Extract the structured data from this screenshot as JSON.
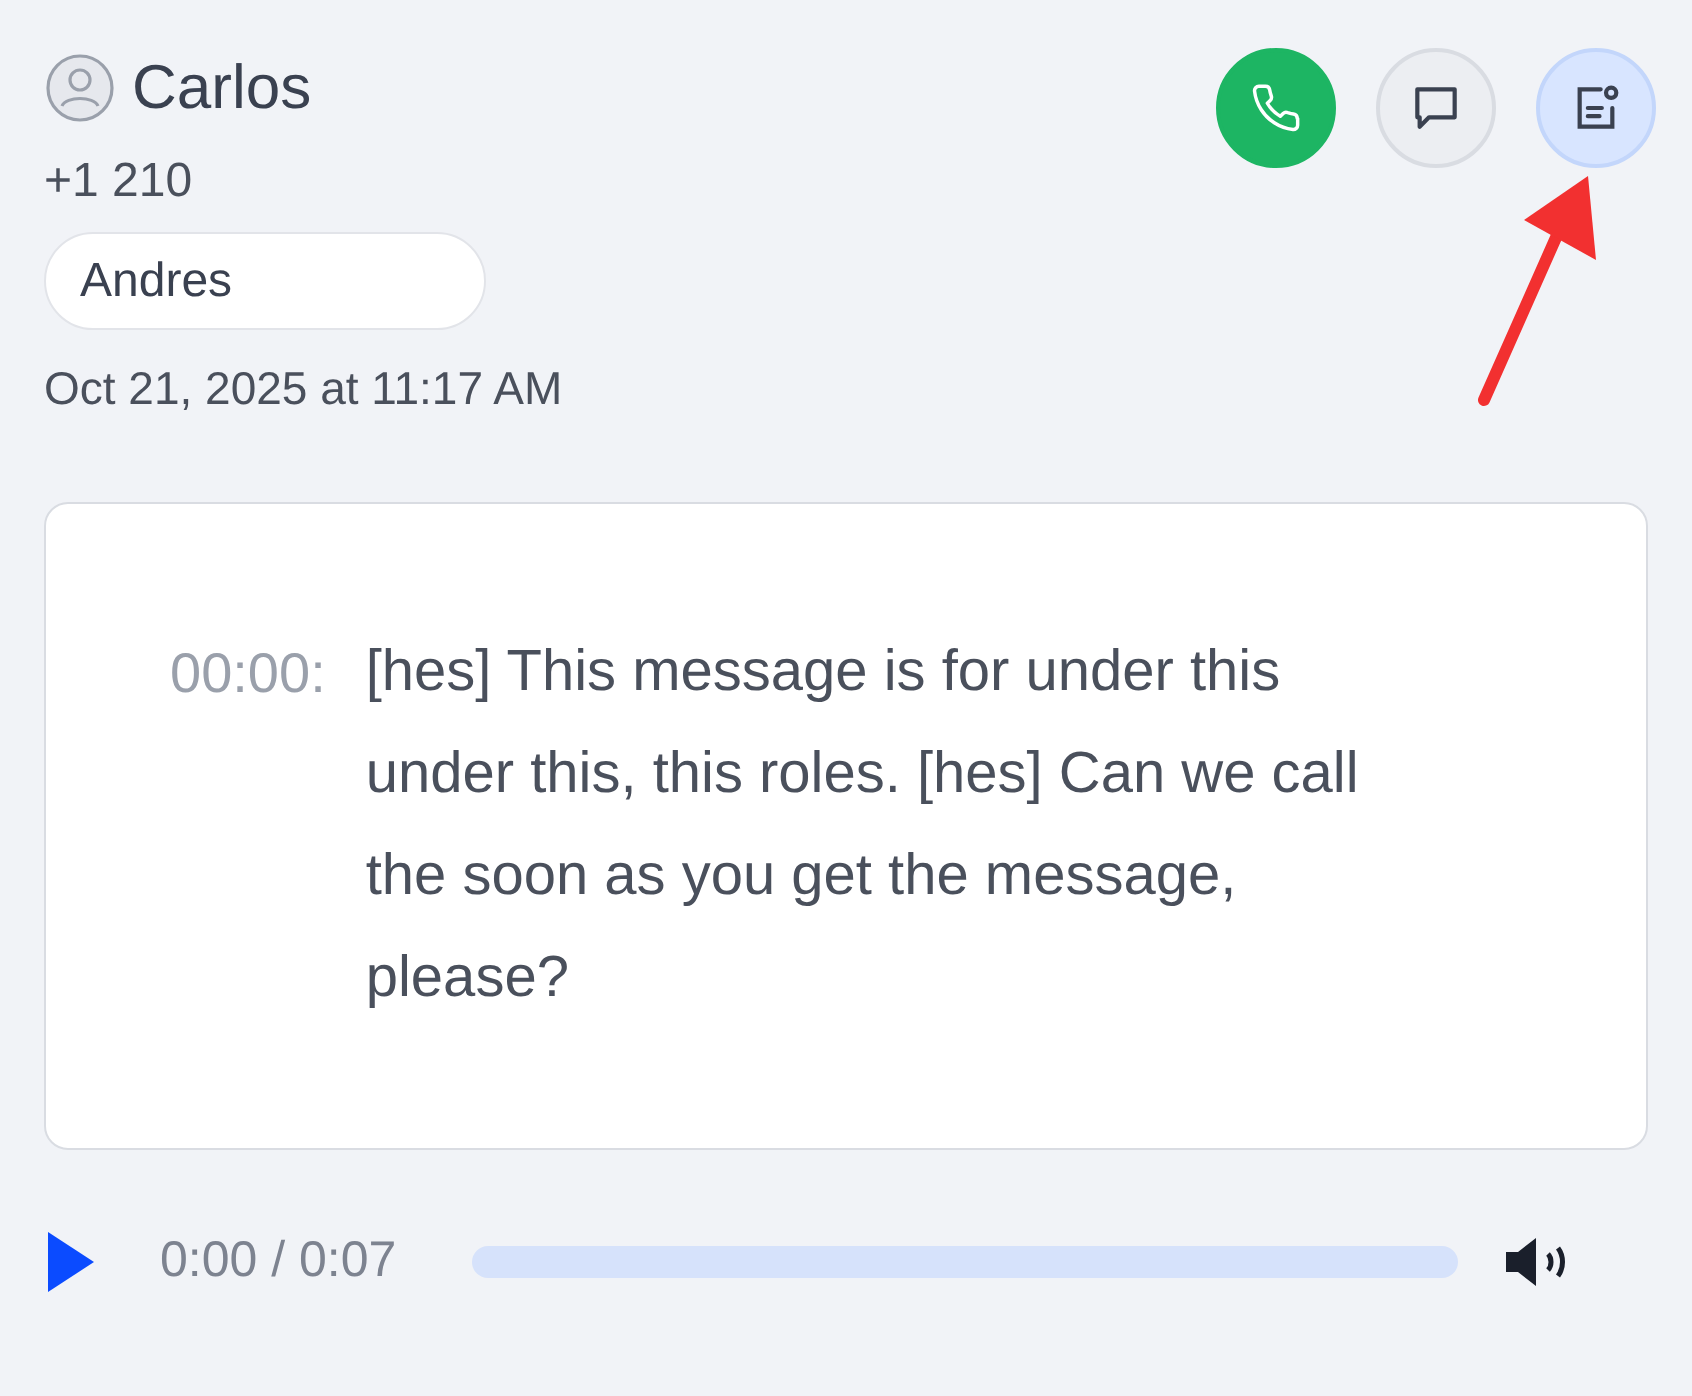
{
  "contact": {
    "name": "Carlos",
    "phone": "+1 210",
    "tag": "Andres",
    "datetime": "Oct 21, 2025 at 11:17 AM"
  },
  "actions": [
    {
      "kind": "call",
      "selected": false
    },
    {
      "kind": "message",
      "selected": false
    },
    {
      "kind": "transcript",
      "selected": true
    }
  ],
  "annotation": {
    "kind": "arrow"
  },
  "transcript": [
    {
      "time": "00:00:",
      "text": "[hes] This message is for under this under this, this roles. [hes] Can we call the soon as you get the message, please?"
    }
  ],
  "player": {
    "position": "0:00 / 0:07",
    "level": 0
  }
}
